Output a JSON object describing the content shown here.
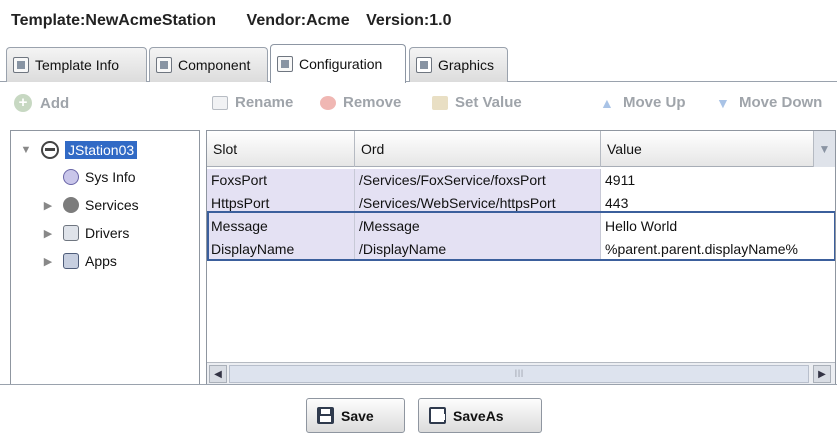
{
  "header": {
    "template": "Template:NewAcmeStation",
    "vendor": "Vendor:Acme",
    "version": "Version:1.0"
  },
  "tabs": [
    {
      "label": "Template Info",
      "icon": "template-info-icon"
    },
    {
      "label": "Component",
      "icon": "component-icon"
    },
    {
      "label": "Configuration",
      "icon": "configuration-icon",
      "active": true
    },
    {
      "label": "Graphics",
      "icon": "graphics-icon"
    }
  ],
  "left": {
    "add_label": "Add"
  },
  "tree": {
    "root": "JStation03",
    "children": [
      {
        "label": "Sys Info",
        "icon": "sys-info-icon"
      },
      {
        "label": "Services",
        "icon": "services-gear-icon"
      },
      {
        "label": "Drivers",
        "icon": "drivers-icon"
      },
      {
        "label": "Apps",
        "icon": "apps-icon"
      }
    ]
  },
  "toolbar": {
    "rename": "Rename",
    "remove": "Remove",
    "set_value": "Set Value",
    "move_up": "Move Up",
    "move_down": "Move Down"
  },
  "table": {
    "columns": [
      "Slot",
      "Ord",
      "Value"
    ],
    "rows": [
      {
        "slot": "FoxsPort",
        "ord": "/Services/FoxService/foxsPort",
        "value": "4911"
      },
      {
        "slot": "HttpsPort",
        "ord": "/Services/WebService/httpsPort",
        "value": "443"
      },
      {
        "slot": "Message",
        "ord": "/Message",
        "value": "Hello World"
      },
      {
        "slot": "DisplayName",
        "ord": "/DisplayName",
        "value": "%parent.parent.displayName%"
      }
    ],
    "scroll_thumb": "III"
  },
  "footer": {
    "save": "Save",
    "save_as": "SaveAs"
  },
  "colors": {
    "selection": "#316ac5",
    "row_tint": "#e4e1f3",
    "highlight_border": "#3b5f9c",
    "disabled_text": "#9fa4aa"
  }
}
